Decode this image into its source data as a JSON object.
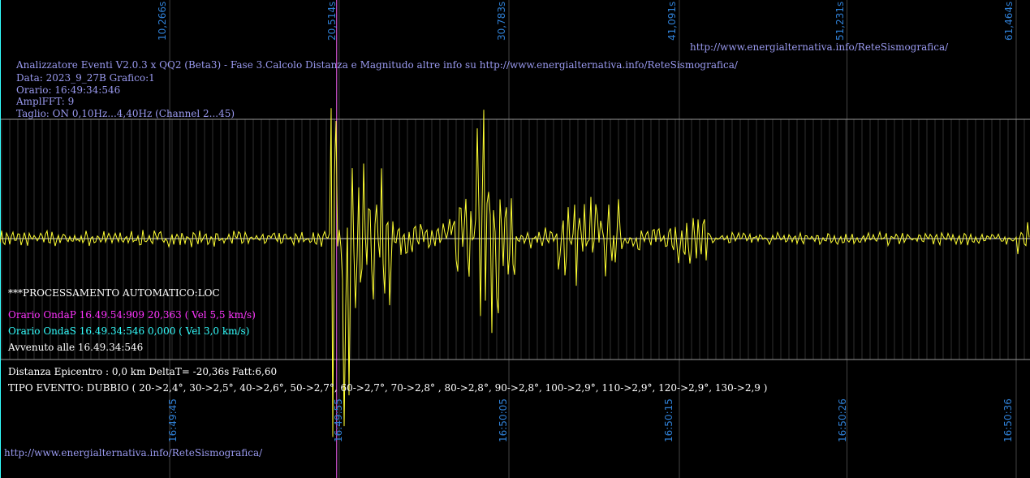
{
  "header": {
    "line1": "Analizzatore Eventi V2.0.3 x QQ2 (Beta3) - Fase 3.Calcolo Distanza e Magnitudo altre info su http://www.energialternativa.info/ReteSismografica/",
    "line2": "Data: 2023_9_27B Grafico:1",
    "line3": "Orario: 16:49:34:546",
    "line4": "AmplFFT: 9",
    "line5": "Taglio: ON 0,10Hz...4,40Hz       (Channel 2...45)"
  },
  "top_url": "http://www.energialternativa.info/ReteSismografica/",
  "bottom_url": "http://www.energialternativa.info/ReteSismografica/",
  "processing": {
    "title": "***PROCESSAMENTO AUTOMATICO:LOC",
    "onda_p": "Orario OndaP 16.49.54:909  20,363 ( Vel 5,5 km/s)",
    "onda_s": "Orario OndaS 16.49.34:546  0,000 ( Vel 3,0 km/s)",
    "avvenuto": "Avvenuto alle 16.49.34:546",
    "distanza": "Distanza Epicentro : 0,0 km DeltaT= -20,36s  Fatt:6,60",
    "tipo": "TIPO EVENTO: DUBBIO ( 20->2,4°, 30->2,5°, 40->2,6°, 50->2,7°, 60->2,7°, 70->2,8° , 80->2,8°, 90->2,8°, 100->2,9°, 110->2,9°, 120->2,9°, 130->2,9 )"
  },
  "colors": {
    "trace": "#ffff33",
    "grid": "#5a5a5a",
    "p_marker": "#ff66ff",
    "s_marker": "#33ffff",
    "tick_text": "#2f7fd4"
  },
  "chart_data": {
    "type": "line",
    "top_ticks": [
      "10,266s",
      "20,514s",
      "30,783s",
      "41,091s",
      "51,231s",
      "61,464s"
    ],
    "top_tick_values_s": [
      10.266,
      20.514,
      30.783,
      41.091,
      51.231,
      61.464
    ],
    "bottom_ticks": [
      "16:49:45",
      "16:49:55",
      "16:50:05",
      "16:50:15",
      "16:50:26",
      "16:50:36"
    ],
    "bottom_tick_values_s": [
      10.5,
      20.5,
      30.5,
      40.5,
      51.0,
      61.0
    ],
    "p_wave_time_s": 20.363,
    "s_wave_time_s": 0.0,
    "x_range_s": [
      0,
      62.3
    ],
    "grid": true,
    "trace_segments": [
      {
        "t0": 0,
        "t1": 20.0,
        "amp": 0.06
      },
      {
        "t0": 20.0,
        "t1": 21.2,
        "amp": 1.4
      },
      {
        "t0": 21.2,
        "t1": 23.8,
        "amp": 0.55
      },
      {
        "t0": 23.8,
        "t1": 27.0,
        "amp": 0.12
      },
      {
        "t0": 27.0,
        "t1": 28.6,
        "amp": 0.35
      },
      {
        "t0": 28.6,
        "t1": 30.2,
        "amp": 1.2
      },
      {
        "t0": 30.2,
        "t1": 31.2,
        "amp": 0.3
      },
      {
        "t0": 31.2,
        "t1": 33.5,
        "amp": 0.08
      },
      {
        "t0": 33.5,
        "t1": 37.5,
        "amp": 0.35
      },
      {
        "t0": 37.5,
        "t1": 40.0,
        "amp": 0.1
      },
      {
        "t0": 40.0,
        "t1": 43.0,
        "amp": 0.18
      },
      {
        "t0": 43.0,
        "t1": 61.5,
        "amp": 0.05
      },
      {
        "t0": 61.5,
        "t1": 62.3,
        "amp": 0.15
      }
    ]
  }
}
